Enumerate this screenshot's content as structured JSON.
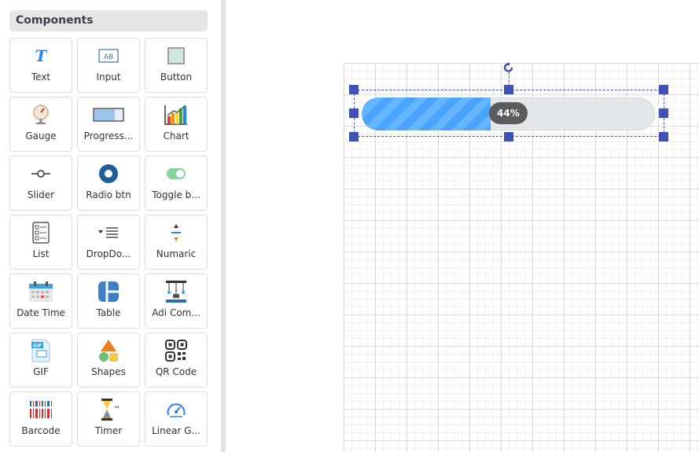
{
  "sidebar": {
    "title": "Components",
    "items": [
      {
        "label": "Text",
        "icon": "text-icon"
      },
      {
        "label": "Input",
        "icon": "input-icon"
      },
      {
        "label": "Button",
        "icon": "button-icon"
      },
      {
        "label": "Gauge",
        "icon": "gauge-icon"
      },
      {
        "label": "Progress...",
        "icon": "progress-icon"
      },
      {
        "label": "Chart",
        "icon": "chart-icon"
      },
      {
        "label": "Slider",
        "icon": "slider-icon"
      },
      {
        "label": "Radio btn",
        "icon": "radio-icon"
      },
      {
        "label": "Toggle b...",
        "icon": "toggle-icon"
      },
      {
        "label": "List",
        "icon": "list-icon"
      },
      {
        "label": "DropDo...",
        "icon": "dropdown-icon"
      },
      {
        "label": "Numaric",
        "icon": "numeric-icon"
      },
      {
        "label": "Date Time",
        "icon": "calendar-icon"
      },
      {
        "label": "Table",
        "icon": "table-icon"
      },
      {
        "label": "Adi Com...",
        "icon": "advanced-component-icon"
      },
      {
        "label": "GIF",
        "icon": "gif-icon"
      },
      {
        "label": "Shapes",
        "icon": "shapes-icon"
      },
      {
        "label": "QR Code",
        "icon": "qr-code-icon"
      },
      {
        "label": "Barcode",
        "icon": "barcode-icon"
      },
      {
        "label": "Timer",
        "icon": "timer-icon"
      },
      {
        "label": "Linear G...",
        "icon": "linear-gauge-icon"
      }
    ]
  },
  "canvas": {
    "progress": {
      "value": 0.44,
      "label": "44%",
      "fill_color": "#4aa3ff",
      "track_color": "#e4e7ea",
      "badge_color": "#5b5b5b"
    },
    "selection_color": "#3f51b5"
  }
}
